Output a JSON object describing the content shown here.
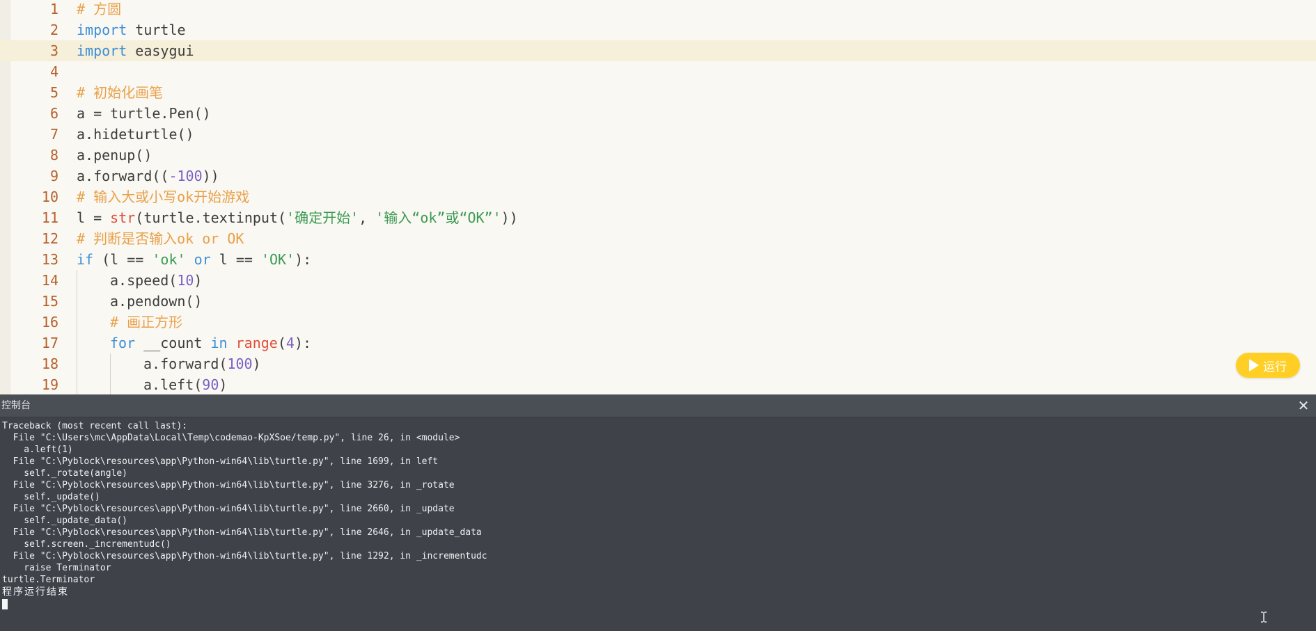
{
  "editor": {
    "active_line": 3,
    "lines": [
      {
        "no": "1",
        "indent": 0,
        "tokens": [
          {
            "t": "# 方圆",
            "c": "com"
          }
        ]
      },
      {
        "no": "2",
        "indent": 0,
        "tokens": [
          {
            "t": "import",
            "c": "kw"
          },
          {
            "t": " turtle",
            "c": "op"
          }
        ]
      },
      {
        "no": "3",
        "indent": 0,
        "tokens": [
          {
            "t": "import",
            "c": "kw"
          },
          {
            "t": " easygui",
            "c": "op"
          }
        ]
      },
      {
        "no": "4",
        "indent": 0,
        "tokens": []
      },
      {
        "no": "5",
        "indent": 0,
        "tokens": [
          {
            "t": "# 初始化画笔",
            "c": "com"
          }
        ]
      },
      {
        "no": "6",
        "indent": 0,
        "tokens": [
          {
            "t": "a = turtle.Pen()",
            "c": "op"
          }
        ]
      },
      {
        "no": "7",
        "indent": 0,
        "tokens": [
          {
            "t": "a.hideturtle()",
            "c": "op"
          }
        ]
      },
      {
        "no": "8",
        "indent": 0,
        "tokens": [
          {
            "t": "a.penup()",
            "c": "op"
          }
        ]
      },
      {
        "no": "9",
        "indent": 0,
        "tokens": [
          {
            "t": "a.forward((",
            "c": "op"
          },
          {
            "t": "-100",
            "c": "num"
          },
          {
            "t": "))",
            "c": "op"
          }
        ]
      },
      {
        "no": "10",
        "indent": 0,
        "tokens": [
          {
            "t": "# 输入大或小写ok开始游戏",
            "c": "com"
          }
        ]
      },
      {
        "no": "11",
        "indent": 0,
        "tokens": [
          {
            "t": "l = ",
            "c": "op"
          },
          {
            "t": "str",
            "c": "bi"
          },
          {
            "t": "(turtle.textinput(",
            "c": "op"
          },
          {
            "t": "'确定开始'",
            "c": "str"
          },
          {
            "t": ", ",
            "c": "op"
          },
          {
            "t": "'输入“ok”或“OK”'",
            "c": "str"
          },
          {
            "t": "))",
            "c": "op"
          }
        ]
      },
      {
        "no": "12",
        "indent": 0,
        "tokens": [
          {
            "t": "# 判断是否输入ok or OK",
            "c": "com"
          }
        ]
      },
      {
        "no": "13",
        "indent": 0,
        "tokens": [
          {
            "t": "if",
            "c": "kw"
          },
          {
            "t": " (l == ",
            "c": "op"
          },
          {
            "t": "'ok'",
            "c": "str"
          },
          {
            "t": " ",
            "c": "op"
          },
          {
            "t": "or",
            "c": "kw"
          },
          {
            "t": " l == ",
            "c": "op"
          },
          {
            "t": "'OK'",
            "c": "str"
          },
          {
            "t": "):",
            "c": "op"
          }
        ]
      },
      {
        "no": "14",
        "indent": 1,
        "tokens": [
          {
            "t": "a.speed(",
            "c": "op"
          },
          {
            "t": "10",
            "c": "num"
          },
          {
            "t": ")",
            "c": "op"
          }
        ]
      },
      {
        "no": "15",
        "indent": 1,
        "tokens": [
          {
            "t": "a.pendown()",
            "c": "op"
          }
        ]
      },
      {
        "no": "16",
        "indent": 1,
        "tokens": [
          {
            "t": "# 画正方形",
            "c": "com"
          }
        ]
      },
      {
        "no": "17",
        "indent": 1,
        "tokens": [
          {
            "t": "for",
            "c": "kw"
          },
          {
            "t": " __count ",
            "c": "op"
          },
          {
            "t": "in",
            "c": "kw"
          },
          {
            "t": " ",
            "c": "op"
          },
          {
            "t": "range",
            "c": "bi"
          },
          {
            "t": "(",
            "c": "op"
          },
          {
            "t": "4",
            "c": "num"
          },
          {
            "t": "):",
            "c": "op"
          }
        ]
      },
      {
        "no": "18",
        "indent": 2,
        "tokens": [
          {
            "t": "a.forward(",
            "c": "op"
          },
          {
            "t": "100",
            "c": "num"
          },
          {
            "t": ")",
            "c": "op"
          }
        ]
      },
      {
        "no": "19",
        "indent": 2,
        "tokens": [
          {
            "t": "a.left(",
            "c": "op"
          },
          {
            "t": "90",
            "c": "num"
          },
          {
            "t": ")",
            "c": "op"
          }
        ]
      }
    ]
  },
  "run_button": {
    "label": "运行",
    "color": "#ffcf26"
  },
  "console": {
    "title": "控制台",
    "close_icon": "close-icon",
    "output_lines": [
      "Traceback (most recent call last):",
      "  File \"C:\\Users\\mc\\AppData\\Local\\Temp\\codemao-KpXSoe/temp.py\", line 26, in <module>",
      "    a.left(1)",
      "  File \"C:\\Pyblock\\resources\\app\\Python-win64\\lib\\turtle.py\", line 1699, in left",
      "    self._rotate(angle)",
      "  File \"C:\\Pyblock\\resources\\app\\Python-win64\\lib\\turtle.py\", line 3276, in _rotate",
      "    self._update()",
      "  File \"C:\\Pyblock\\resources\\app\\Python-win64\\lib\\turtle.py\", line 2660, in _update",
      "    self._update_data()",
      "  File \"C:\\Pyblock\\resources\\app\\Python-win64\\lib\\turtle.py\", line 2646, in _update_data",
      "    self.screen._incrementudc()",
      "  File \"C:\\Pyblock\\resources\\app\\Python-win64\\lib\\turtle.py\", line 1292, in _incrementudc",
      "    raise Terminator",
      "turtle.Terminator"
    ],
    "end_message": "程序运行结束"
  }
}
